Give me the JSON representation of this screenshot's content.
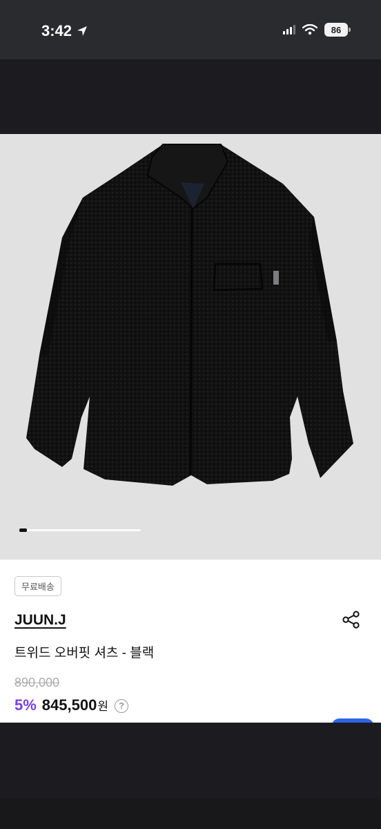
{
  "status_bar": {
    "time": "3:42",
    "battery": "86"
  },
  "product": {
    "badge": "무료배송",
    "brand": "JUUN.J",
    "name": "트위드 오버핏 셔츠 - 블랙",
    "original_price": "890,000",
    "discount": "5%",
    "price": "845,500",
    "currency": "원",
    "help_icon_label": "?"
  },
  "carousel": {
    "progress": 0.06
  },
  "colors": {
    "accent": "#7a3de8",
    "button": "#2f65e8",
    "image_bg": "#e1e1e1"
  },
  "icons": [
    "location-arrow-icon",
    "signal-icon",
    "wifi-icon",
    "battery-icon",
    "share-icon",
    "help-icon"
  ]
}
